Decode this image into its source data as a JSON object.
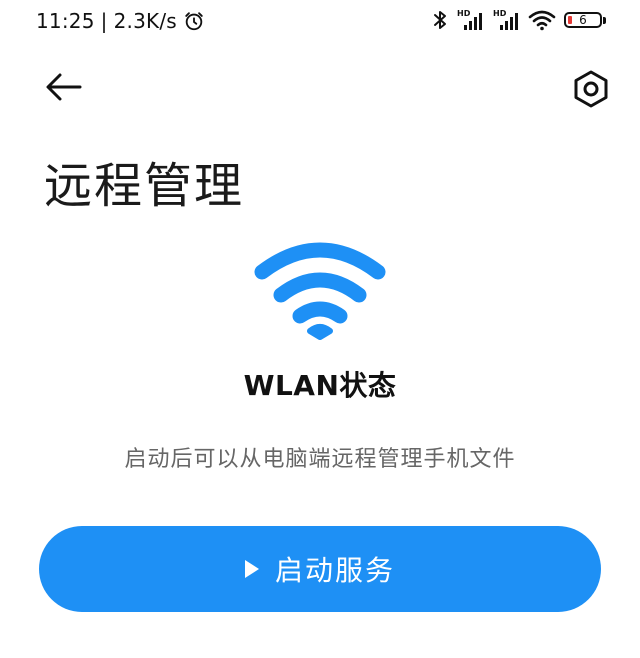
{
  "status_bar": {
    "time": "11:25",
    "separator": "|",
    "network_speed": "2.3K/s",
    "battery_level": "6",
    "icons": [
      "alarm-icon",
      "bluetooth-icon",
      "hd-signal-icon",
      "hd-signal-icon",
      "wifi-icon",
      "battery-icon"
    ]
  },
  "header": {
    "back_icon": "back-arrow-icon",
    "settings_icon": "settings-hexagon-icon"
  },
  "page": {
    "title": "远程管理",
    "status_title": "WLAN状态",
    "description": "启动后可以从电脑端远程管理手机文件",
    "hero_icon": "wifi-icon"
  },
  "action": {
    "start_label": "启动服务",
    "icon": "play-icon"
  },
  "colors": {
    "accent": "#1e90f5",
    "background": "#ffffff",
    "text": "#111111",
    "secondary_text": "#666666",
    "battery_low": "#e53935"
  }
}
